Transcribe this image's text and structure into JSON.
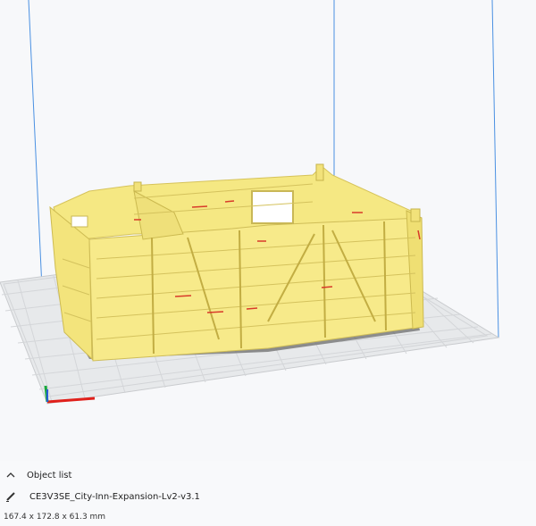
{
  "object_list": {
    "header_label": "Object list",
    "collapse_icon": "chevron-up-icon",
    "edit_icon": "pencil-icon",
    "file_name": "CE3V3SE_City-Inn-Expansion-Lv2-v3.1",
    "dimensions": "167.4 x 172.8 x 61.3 mm"
  },
  "colors": {
    "model_fill": "#f7e98c",
    "model_shade": "#d9c866",
    "build_plate": "#dfe1e3",
    "build_volume_line": "#4a90e2",
    "axis_x": "#e0201b",
    "axis_y": "#18a83c",
    "axis_z": "#2a5bd7"
  }
}
